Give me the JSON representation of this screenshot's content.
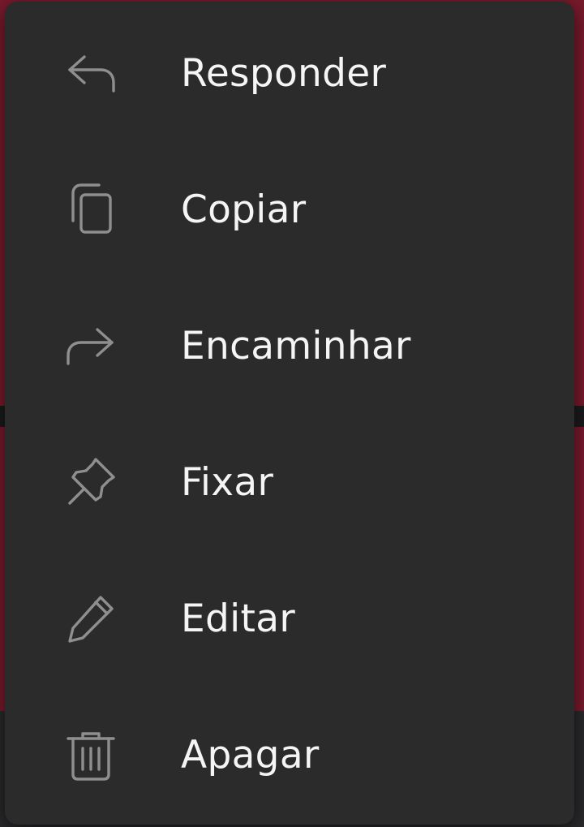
{
  "menu": {
    "items": [
      {
        "label": "Responder",
        "icon": "reply-icon"
      },
      {
        "label": "Copiar",
        "icon": "copy-icon"
      },
      {
        "label": "Encaminhar",
        "icon": "forward-icon"
      },
      {
        "label": "Fixar",
        "icon": "pin-icon"
      },
      {
        "label": "Editar",
        "icon": "pencil-icon"
      },
      {
        "label": "Apagar",
        "icon": "trash-icon"
      }
    ]
  },
  "colors": {
    "menu_background": "#2b2b2b",
    "icon": "#8f8f8f",
    "label_text": "#f5f5f5",
    "backdrop_message": "#7a1a2d"
  }
}
